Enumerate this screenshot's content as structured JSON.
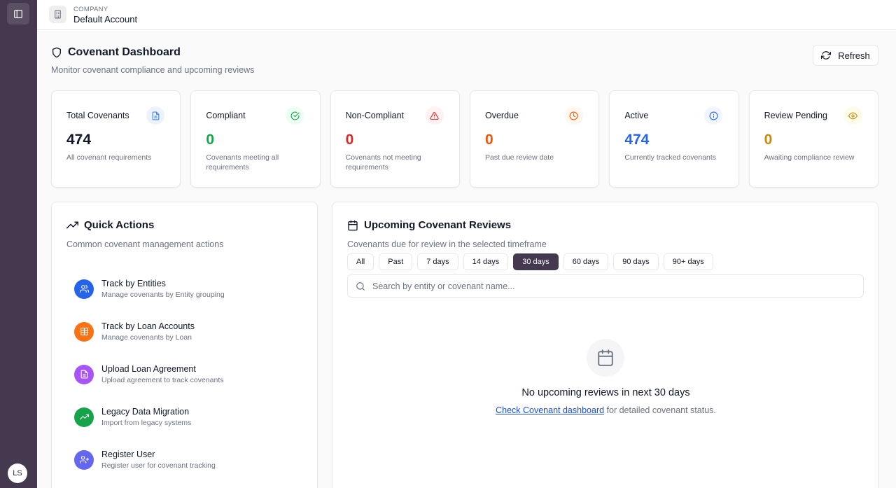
{
  "user": {
    "initials": "LS"
  },
  "header": {
    "company_label": "COMPANY",
    "company_name": "Default Account"
  },
  "page": {
    "title": "Covenant Dashboard",
    "subtitle": "Monitor covenant compliance and upcoming reviews",
    "refresh_label": "Refresh"
  },
  "stats": [
    {
      "title": "Total Covenants",
      "value": "474",
      "desc": "All covenant requirements",
      "icon": "document-icon",
      "color": "#111827",
      "icon_color": "#3b82f6",
      "icon_bg": "#eef2ff"
    },
    {
      "title": "Compliant",
      "value": "0",
      "desc": "Covenants meeting all requirements",
      "icon": "check-circle-icon",
      "color": "#16a34a",
      "icon_color": "#16a34a",
      "icon_bg": "#ecfdf3"
    },
    {
      "title": "Non-Compliant",
      "value": "0",
      "desc": "Covenants not meeting requirements",
      "icon": "alert-triangle-icon",
      "color": "#dc2626",
      "icon_color": "#dc2626",
      "icon_bg": "#fef2f2"
    },
    {
      "title": "Overdue",
      "value": "0",
      "desc": "Past due review date",
      "icon": "clock-icon",
      "color": "#ea580c",
      "icon_color": "#ea580c",
      "icon_bg": "#fff7ed"
    },
    {
      "title": "Active",
      "value": "474",
      "desc": "Currently tracked covenants",
      "icon": "info-circle-icon",
      "color": "#2563eb",
      "icon_color": "#2563eb",
      "icon_bg": "#eff6ff"
    },
    {
      "title": "Review Pending",
      "value": "0",
      "desc": "Awaiting compliance review",
      "icon": "eye-icon",
      "color": "#ca8a04",
      "icon_color": "#ca8a04",
      "icon_bg": "#fefce8"
    }
  ],
  "quick_actions": {
    "title": "Quick Actions",
    "subtitle": "Common covenant management actions",
    "items": [
      {
        "label": "Track by Entities",
        "desc": "Manage covenants by Entity grouping",
        "icon": "users-icon",
        "bg": "#2563eb"
      },
      {
        "label": "Track by Loan Accounts",
        "desc": "Manage covenants by Loan",
        "icon": "table-icon",
        "bg": "#f97316"
      },
      {
        "label": "Upload Loan Agreement",
        "desc": "Upload agreement to track covenants",
        "icon": "file-icon",
        "bg": "#a855f7"
      },
      {
        "label": "Legacy Data Migration",
        "desc": "Import from legacy systems",
        "icon": "trending-up-icon",
        "bg": "#16a34a"
      },
      {
        "label": "Register User",
        "desc": "Register user for covenant tracking",
        "icon": "user-plus-icon",
        "bg": "#6366f1"
      }
    ]
  },
  "upcoming": {
    "title": "Upcoming Covenant Reviews",
    "subtitle": "Covenants due for review in the selected timeframe",
    "filters": [
      "All",
      "Past",
      "7 days",
      "14 days",
      "30 days",
      "60 days",
      "90 days",
      "90+ days"
    ],
    "active_filter": "30 days",
    "search_placeholder": "Search by entity or covenant name...",
    "empty_title": "No upcoming reviews in next 30 days",
    "empty_link": "Check Covenant dashboard",
    "empty_suffix": " for detailed covenant status."
  }
}
